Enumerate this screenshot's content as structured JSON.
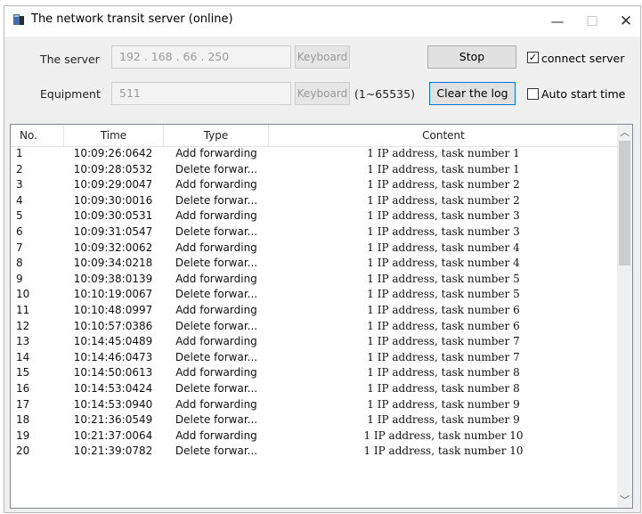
{
  "window": {
    "title": "The network transit server (online)",
    "min_glyph": "—",
    "max_glyph": "☐",
    "close_glyph": "✕"
  },
  "form": {
    "server_label": "The server",
    "server_ip": "192  .  168  .  66   .  250",
    "keyboard_label": "Keyboard",
    "stop_label": "Stop",
    "connect_label": "connect server",
    "connect_checked": true,
    "equipment_label": "Equipment",
    "equipment_value": "511",
    "keyboard2_label": "Keyboard",
    "range_label": "(1~65535)",
    "clear_label": "Clear the log",
    "autostart_label": "Auto start time",
    "autostart_checked": false
  },
  "table": {
    "headers": [
      "No.",
      "Time",
      "Type",
      "Content"
    ],
    "rows": [
      [
        "1",
        "10:09:26:0642",
        "Add forwarding",
        "1 IP address, task number 1"
      ],
      [
        "2",
        "10:09:28:0532",
        "Delete forwar...",
        "1 IP address, task number 1"
      ],
      [
        "3",
        "10:09:29:0047",
        "Add forwarding",
        "1 IP address, task number 2"
      ],
      [
        "4",
        "10:09:30:0016",
        "Delete forwar...",
        "1 IP address, task number 2"
      ],
      [
        "5",
        "10:09:30:0531",
        "Add forwarding",
        "1 IP address, task number 3"
      ],
      [
        "6",
        "10:09:31:0547",
        "Delete forwar...",
        "1 IP address, task number 3"
      ],
      [
        "7",
        "10:09:32:0062",
        "Add forwarding",
        "1 IP address, task number 4"
      ],
      [
        "8",
        "10:09:34:0218",
        "Delete forwar...",
        "1 IP address, task number 4"
      ],
      [
        "9",
        "10:09:38:0139",
        "Add forwarding",
        "1 IP address, task number 5"
      ],
      [
        "10",
        "10:10:19:0067",
        "Delete forwar...",
        "1 IP address, task number 5"
      ],
      [
        "11",
        "10:10:48:0997",
        "Add forwarding",
        "1 IP address, task number 6"
      ],
      [
        "12",
        "10:10:57:0386",
        "Delete forwar...",
        "1 IP address, task number 6"
      ],
      [
        "13",
        "10:14:45:0489",
        "Add forwarding",
        "1 IP address, task number 7"
      ],
      [
        "14",
        "10:14:46:0473",
        "Delete forwar...",
        "1 IP address, task number 7"
      ],
      [
        "15",
        "10:14:50:0613",
        "Add forwarding",
        "1 IP address, task number 8"
      ],
      [
        "16",
        "10:14:53:0424",
        "Delete forwar...",
        "1 IP address, task number 8"
      ],
      [
        "17",
        "10:14:53:0940",
        "Add forwarding",
        "1 IP address, task number 9"
      ],
      [
        "18",
        "10:21:36:0549",
        "Delete forwar...",
        "1 IP address, task number 9"
      ],
      [
        "19",
        "10:21:37:0064",
        "Add forwarding",
        "1 IP address, task number 10"
      ],
      [
        "20",
        "10:21:39:0782",
        "Delete forwar...",
        "1 IP address, task number 10"
      ]
    ]
  },
  "icons": {
    "app": "server-app-icon",
    "scroll_up": "chevron-up-icon",
    "scroll_down": "chevron-down-icon"
  },
  "colors": {
    "focus_border": "#0078d7",
    "background": "#f0f0f0"
  }
}
